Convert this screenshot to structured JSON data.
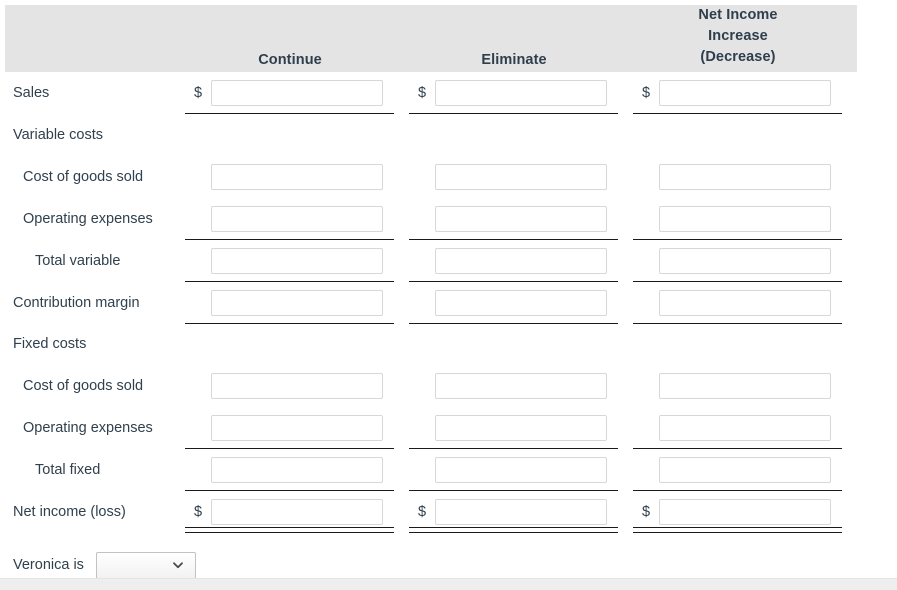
{
  "header": {
    "columns": [
      {
        "label": "Continue"
      },
      {
        "label": "Eliminate"
      },
      {
        "label": "Net Income\nIncrease\n(Decrease)"
      }
    ],
    "net_income_line1": "Net Income",
    "net_income_line2": "Increase",
    "net_income_line3": "(Decrease)"
  },
  "currency_symbol": "$",
  "rows": [
    {
      "label": "Sales",
      "indent": 0,
      "dollar": true,
      "rule": "single",
      "value": "",
      "placeholder": ""
    },
    {
      "label": "Variable costs",
      "indent": 0,
      "dollar": false,
      "rule": "none",
      "value": "",
      "placeholder": "",
      "inputs": false
    },
    {
      "label": "Cost of goods sold",
      "indent": 1,
      "dollar": false,
      "rule": "none",
      "value": "",
      "placeholder": ""
    },
    {
      "label": "Operating expenses",
      "indent": 1,
      "dollar": false,
      "rule": "single",
      "value": "",
      "placeholder": ""
    },
    {
      "label": "Total variable",
      "indent": 2,
      "dollar": false,
      "rule": "single",
      "value": "",
      "placeholder": ""
    },
    {
      "label": "Contribution margin",
      "indent": 0,
      "dollar": false,
      "rule": "single",
      "value": "",
      "placeholder": ""
    },
    {
      "label": "Fixed costs",
      "indent": 0,
      "dollar": false,
      "rule": "none",
      "value": "",
      "placeholder": "",
      "inputs": false
    },
    {
      "label": "Cost of goods sold",
      "indent": 1,
      "dollar": false,
      "rule": "none",
      "value": "",
      "placeholder": ""
    },
    {
      "label": "Operating expenses",
      "indent": 1,
      "dollar": false,
      "rule": "single",
      "value": "",
      "placeholder": ""
    },
    {
      "label": "Total fixed",
      "indent": 2,
      "dollar": false,
      "rule": "single",
      "value": "",
      "placeholder": ""
    },
    {
      "label": "Net income (loss)",
      "indent": 0,
      "dollar": true,
      "rule": "double",
      "value": "",
      "placeholder": ""
    }
  ],
  "bottom": {
    "question_label": "Veronica is",
    "select_value": "",
    "select_options": [
      ""
    ]
  },
  "colors": {
    "header_band": "#e4e4e4",
    "text": "#30404d",
    "rule": "#1a1a1a",
    "input_border": "#d5d7da",
    "footer": "#eeeeee"
  }
}
